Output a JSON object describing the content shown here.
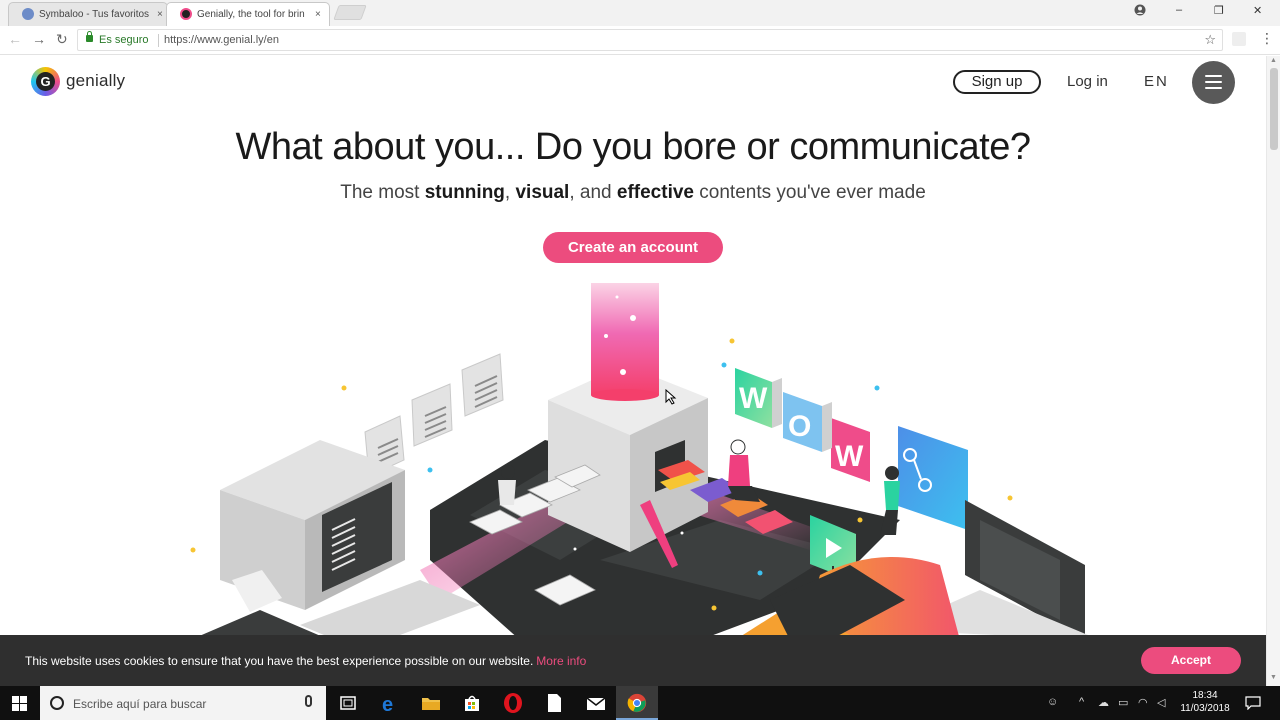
{
  "browser": {
    "tabs": [
      {
        "title": "Symbaloo - Tus favoritos",
        "close": "×",
        "favicon_color": "#6d8cc8"
      },
      {
        "title": "Genially, the tool for brin",
        "close": "×",
        "favicon_color": "#222222"
      }
    ],
    "window_controls": {
      "minimize": "–",
      "restore": "❐",
      "close": "✕"
    },
    "nav": {
      "back": "←",
      "forward": "→",
      "reload": "↻"
    },
    "address": {
      "secure_label": "Es seguro",
      "url": "https://www.genial.ly/en"
    },
    "bookmark_icon": "☆",
    "menu_icon": "⋮"
  },
  "site": {
    "brand": "genially",
    "logo_letter": "G",
    "nav": {
      "signup": "Sign up",
      "login": "Log in",
      "lang": "EN"
    },
    "headline": "What about you... Do you bore or communicate?",
    "subline": {
      "part1": "The most ",
      "bold1": "stunning",
      "part2": ", ",
      "bold2": "visual",
      "part3": ", and ",
      "bold3": "effective",
      "part4": " contents you've ever made"
    },
    "cta": "Create an account",
    "illustration_letters": [
      "W",
      "O",
      "W"
    ]
  },
  "cookie": {
    "text": "This website uses cookies to ensure that you have the best experience possible on our website.",
    "more_info": "More info",
    "accept": "Accept"
  },
  "taskbar": {
    "search_placeholder": "Escribe aquí para buscar",
    "time": "18:34",
    "date": "11/03/2018",
    "colors": {
      "accent": "#ec4c7e",
      "taskbar": "#101010",
      "edge": "#1e78d7",
      "opera": "#e0141e"
    }
  }
}
